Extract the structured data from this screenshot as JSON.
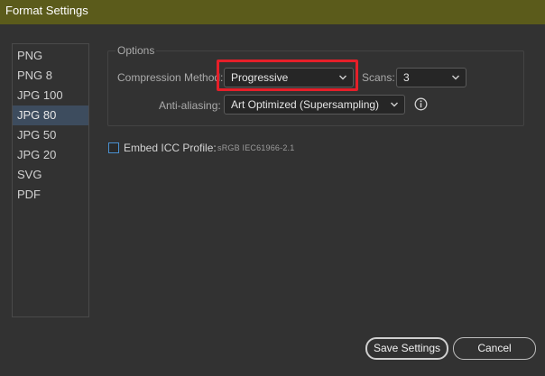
{
  "window": {
    "title": "Format Settings"
  },
  "formats": {
    "items": [
      "PNG",
      "PNG 8",
      "JPG 100",
      "JPG 80",
      "JPG 50",
      "JPG 20",
      "SVG",
      "PDF"
    ],
    "selected": "JPG 80"
  },
  "options": {
    "title": "Options",
    "compression_label": "Compression Method:",
    "compression_value": "Progressive",
    "scans_label": "Scans:",
    "scans_value": "3",
    "antialiasing_label": "Anti-aliasing:",
    "antialiasing_value": "Art Optimized (Supersampling)"
  },
  "icc": {
    "label": "Embed ICC Profile:",
    "profile": "sRGB IEC61966-2.1",
    "checked": false
  },
  "buttons": {
    "save": "Save Settings",
    "cancel": "Cancel"
  },
  "colors": {
    "titlebar": "#5b5b1b",
    "selection": "#3d4c5e",
    "highlight": "#e51f29",
    "checkbox_border": "#4a90d0"
  },
  "icons": {
    "dropdown": "chevron-down-icon",
    "info": "info-icon"
  }
}
